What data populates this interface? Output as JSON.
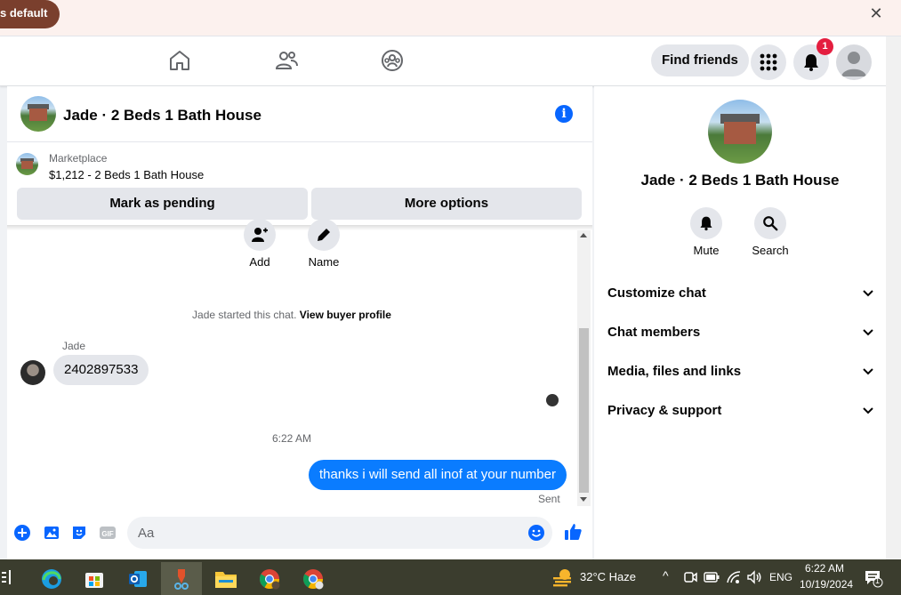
{
  "banner": {
    "text": "s default",
    "close_icon": "close-icon"
  },
  "nav": {
    "find_friends": "Find friends",
    "notification_count": "1"
  },
  "chat": {
    "title": "Jade · 2 Beds 1 Bath House",
    "marketplace": {
      "label": "Marketplace",
      "listing": "$1,212 - 2 Beds 1 Bath House",
      "mark_pending": "Mark as pending",
      "more_options": "More options"
    },
    "actions": [
      {
        "label": "Add",
        "icon": "add-person-icon"
      },
      {
        "label": "Name",
        "icon": "pencil-icon"
      }
    ],
    "started_text": "Jade started this chat.",
    "view_buyer_profile": "View buyer profile",
    "sender_name": "Jade",
    "incoming_message": "2402897533",
    "timestamp": "6:22 AM",
    "outgoing_message": "thanks i will send all inof at your number",
    "sent_status": "Sent",
    "composer_placeholder": "Aa"
  },
  "side": {
    "title": "Jade · 2 Beds 1 Bath House",
    "actions": [
      {
        "label": "Mute",
        "icon": "bell-icon"
      },
      {
        "label": "Search",
        "icon": "search-icon"
      }
    ],
    "sections": [
      "Customize chat",
      "Chat members",
      "Media, files and links",
      "Privacy & support"
    ]
  },
  "taskbar": {
    "weather": "32°C  Haze",
    "language": "ENG",
    "time": "6:22 AM",
    "date": "10/19/2024",
    "notification_count": "1"
  },
  "colors": {
    "accent": "#0866ff",
    "outgoing_bubble": "#0a7cff",
    "badge": "#e41e3f",
    "banner_pill": "#7a3f2d",
    "taskbar": "#3b3d2e"
  }
}
